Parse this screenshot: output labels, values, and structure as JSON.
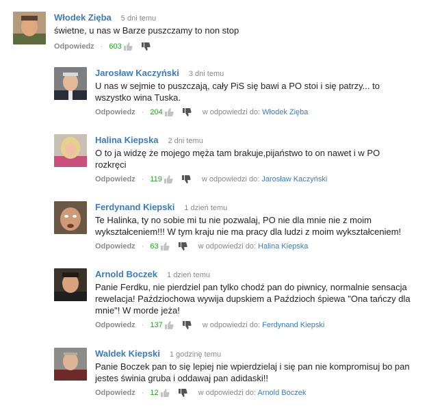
{
  "labels": {
    "reply": "Odpowiedz",
    "in_reply_to": "w odpowiedzi do:",
    "separator": "·"
  },
  "colors": {
    "author": "#3d7ab8",
    "likes": "#2a9d2a",
    "muted": "#888888"
  },
  "comments": [
    {
      "author": "Włodek Zięba",
      "time": "5 dni temu",
      "text": "świetne, u nas w Barze puszczamy to non stop",
      "likes": "603",
      "in_reply_to": ""
    },
    {
      "author": "Jarosław Kaczyński",
      "time": "3 dni temu",
      "text": "U nas w sejmie to puszczają, cały PiS się bawi a PO stoi i się patrzy... to wszystko wina Tuska.",
      "likes": "204",
      "in_reply_to": "Włodek Zięba"
    },
    {
      "author": "Halina Kiepska",
      "time": "2 dni temu",
      "text": "O to ja widzę że mojego męża tam brakuje,pijaństwo to on nawet i w PO rozkręci",
      "likes": "119",
      "in_reply_to": "Jarosław Kaczyński"
    },
    {
      "author": "Ferdynand Kiepski",
      "time": "1 dzień temu",
      "text": "Te Halinka, ty no sobie mi tu nie pozwalaj, PO nie dla mnie nie z moim wykształceniem!!! W tym kraju nie ma pracy dla ludzi z moim wykształceniem!",
      "likes": "63",
      "in_reply_to": "Halina Kiepska"
    },
    {
      "author": "Arnold Boczek",
      "time": "1 dzień temu",
      "text": "Panie Ferdku, nie pierdziel pan tylko chodź pan do piwnicy, normalnie sensacja rewelacja! Paździochowa wywija dupskiem a Paździoch śpiewa \"Ona tańczy dla mnie\"! W morde jeża!",
      "likes": "137",
      "in_reply_to": "Ferdynand Kiepski"
    },
    {
      "author": "Waldek Kiepski",
      "time": "1 godzinę temu",
      "text": "Panie Boczek pan to się lepiej nie wpierdzielaj i się pan nie kompromisuj bo pan jestes świnia gruba i oddawaj pan adidaski!!",
      "likes": "12",
      "in_reply_to": "Arnold Boczek"
    }
  ]
}
